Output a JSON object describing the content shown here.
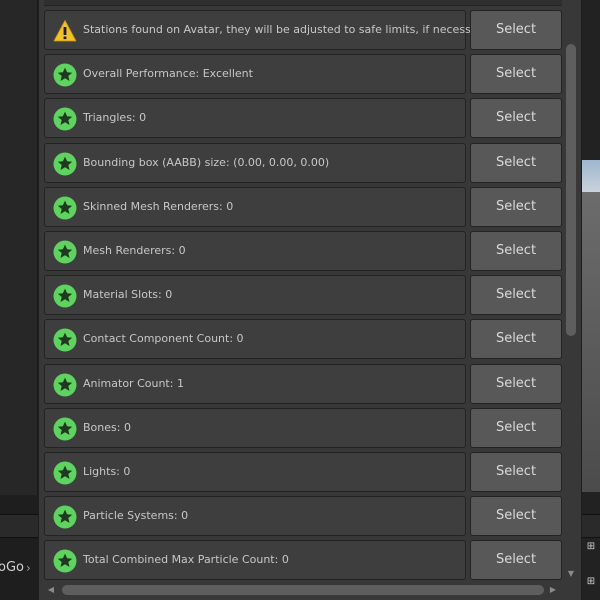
{
  "background": {
    "crumb_text": "oGo",
    "right_small_1": "⊞",
    "right_small_2": "⊞"
  },
  "colors": {
    "ok_icon": "#5fd35f",
    "warning_icon": "#f2c12e",
    "button_bg": "#585858",
    "panel_bg": "#383838"
  },
  "rows": [
    {
      "status": "warning",
      "icon": "warning-icon",
      "text": "Stations found on Avatar, they will be adjusted to safe limits, if necessary.",
      "button": "Select"
    },
    {
      "status": "excellent",
      "icon": "star-icon",
      "text": "Overall Performance: Excellent",
      "button": "Select"
    },
    {
      "status": "excellent",
      "icon": "star-icon",
      "text": "Triangles: 0",
      "button": "Select"
    },
    {
      "status": "excellent",
      "icon": "star-icon",
      "text": "Bounding box (AABB) size: (0.00, 0.00, 0.00)",
      "button": "Select"
    },
    {
      "status": "excellent",
      "icon": "star-icon",
      "text": "Skinned Mesh Renderers: 0",
      "button": "Select"
    },
    {
      "status": "excellent",
      "icon": "star-icon",
      "text": "Mesh Renderers: 0",
      "button": "Select"
    },
    {
      "status": "excellent",
      "icon": "star-icon",
      "text": "Material Slots: 0",
      "button": "Select"
    },
    {
      "status": "excellent",
      "icon": "star-icon",
      "text": "Contact Component Count: 0",
      "button": "Select"
    },
    {
      "status": "excellent",
      "icon": "star-icon",
      "text": "Animator Count: 1",
      "button": "Select"
    },
    {
      "status": "excellent",
      "icon": "star-icon",
      "text": "Bones: 0",
      "button": "Select"
    },
    {
      "status": "excellent",
      "icon": "star-icon",
      "text": "Lights: 0",
      "button": "Select"
    },
    {
      "status": "excellent",
      "icon": "star-icon",
      "text": "Particle Systems: 0",
      "button": "Select"
    },
    {
      "status": "excellent",
      "icon": "star-icon",
      "text": "Total Combined Max Particle Count: 0",
      "button": "Select"
    }
  ]
}
